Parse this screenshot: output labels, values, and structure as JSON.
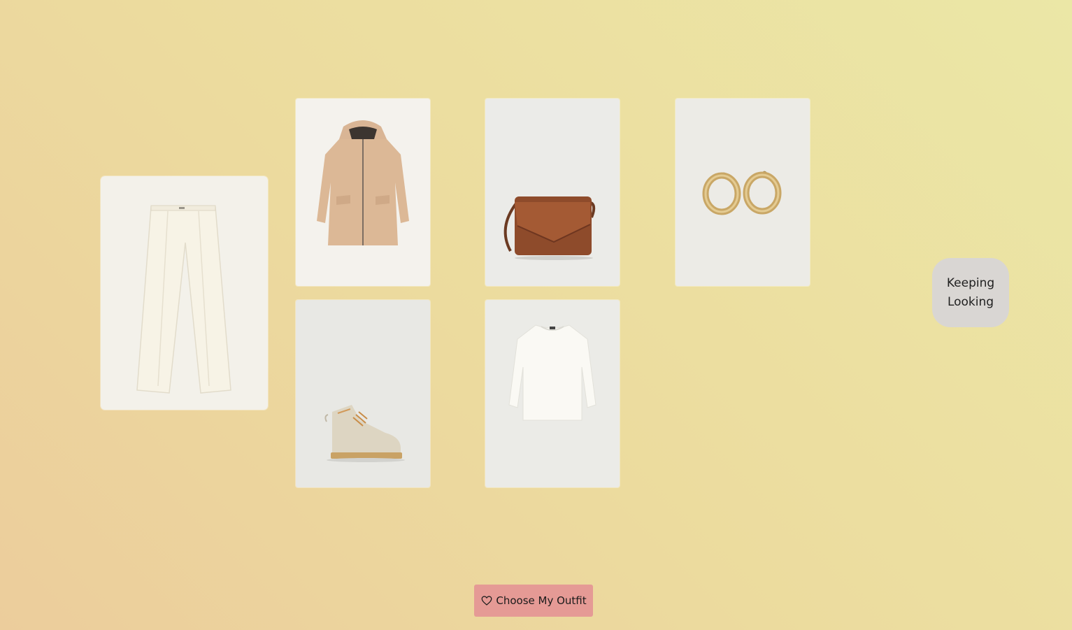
{
  "items": [
    {
      "id": "pants",
      "icon": "wide-leg-trousers-image"
    },
    {
      "id": "coat",
      "icon": "hooded-coat-image"
    },
    {
      "id": "bag",
      "icon": "leather-crossbody-bag-image"
    },
    {
      "id": "earrings",
      "icon": "gold-hoop-earrings-image"
    },
    {
      "id": "boots",
      "icon": "lace-up-boots-image"
    },
    {
      "id": "sweater",
      "icon": "white-sweater-image"
    }
  ],
  "actions": {
    "keep_looking_label": "Keeping\nLooking",
    "choose_outfit_label": "Choose My Outfit"
  },
  "colors": {
    "background_start": "#eccd9c",
    "background_end": "#ebe7a6",
    "choose_button": "#e59a95",
    "keep_button": "#d9d6d3"
  }
}
